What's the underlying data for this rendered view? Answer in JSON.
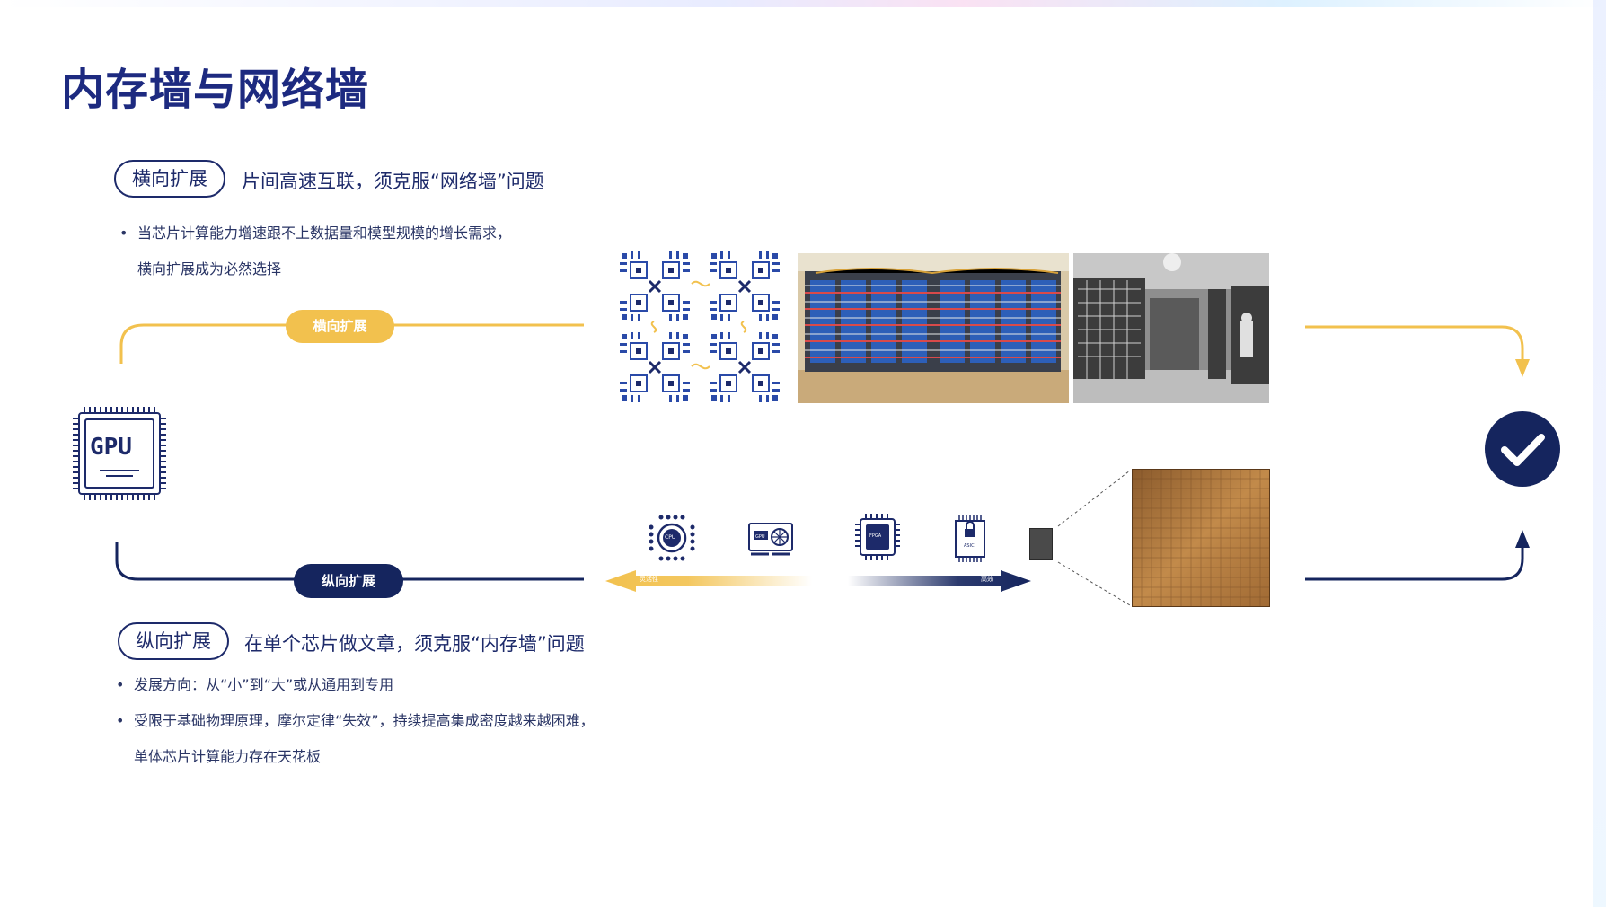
{
  "title": "内存墙与网络墙",
  "horizontal": {
    "tag": "横向扩展",
    "heading": "片间高速互联，须克服“网络墙”问题",
    "bullet_line1": "当芯片计算能力增速跟不上数据量和模型规模的增长需求，",
    "bullet_line2": "横向扩展成为必然选择",
    "flow_label": "横向扩展"
  },
  "vertical": {
    "tag": "纵向扩展",
    "heading": "在单个芯片做文章，须克服“内存墙”问题",
    "bullet1": "发展方向：从“小”到“大”或从通用到专用",
    "bullet2_line1": "受限于基础物理原理，摩尔定律“失效”，持续提高集成密度越来越困难，",
    "bullet2_line2": "单体芯片计算能力存在天花板",
    "flow_label": "纵向扩展"
  },
  "gpu_chip_label": "GPU",
  "chip_row": {
    "cpu": "CPU",
    "gpu": "GPU",
    "fpga": "FPGA",
    "asic": "ASIC",
    "arrow_left_label": "灵活性",
    "arrow_right_label": "高效"
  },
  "colors": {
    "navy": "#1d2a6a",
    "title_blue": "#1d2a80",
    "gold": "#f2c14e",
    "dark_navy": "#15255e"
  },
  "icons": [
    "gpu-chip-icon",
    "check-circle-icon",
    "cpu-chip-icon",
    "gpu-card-icon",
    "fpga-chip-icon",
    "asic-chip-icon"
  ]
}
